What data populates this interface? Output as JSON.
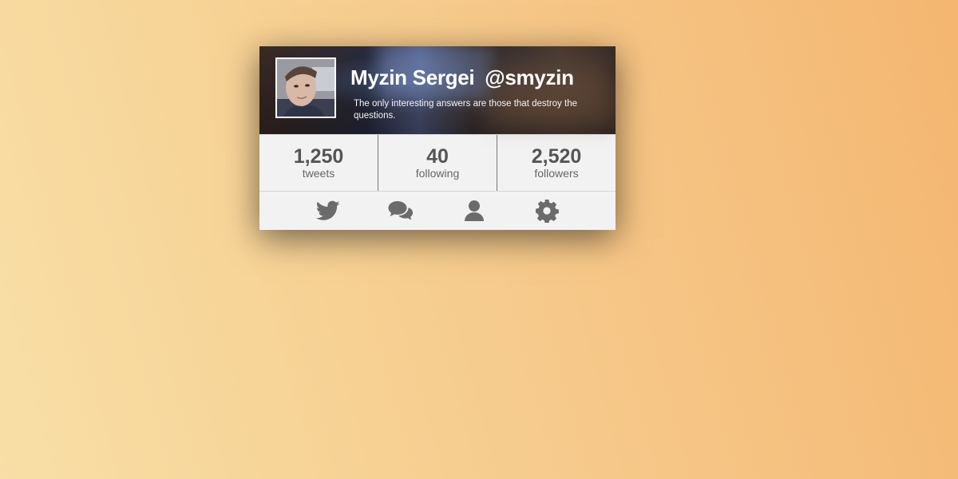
{
  "profile": {
    "name": "Myzin Sergei",
    "handle": "@smyzin",
    "bio": "The only interesting answers are those that destroy the questions."
  },
  "stats": [
    {
      "value": "1,250",
      "label": "tweets"
    },
    {
      "value": "40",
      "label": "following"
    },
    {
      "value": "2,520",
      "label": "followers"
    }
  ],
  "actions": [
    {
      "icon": "twitter-bird-icon"
    },
    {
      "icon": "chat-bubbles-icon"
    },
    {
      "icon": "user-icon"
    },
    {
      "icon": "gear-icon"
    }
  ],
  "colors": {
    "icon": "#6b6b6b",
    "card_background": "#f2f2f2",
    "stat_text": "#555555"
  }
}
